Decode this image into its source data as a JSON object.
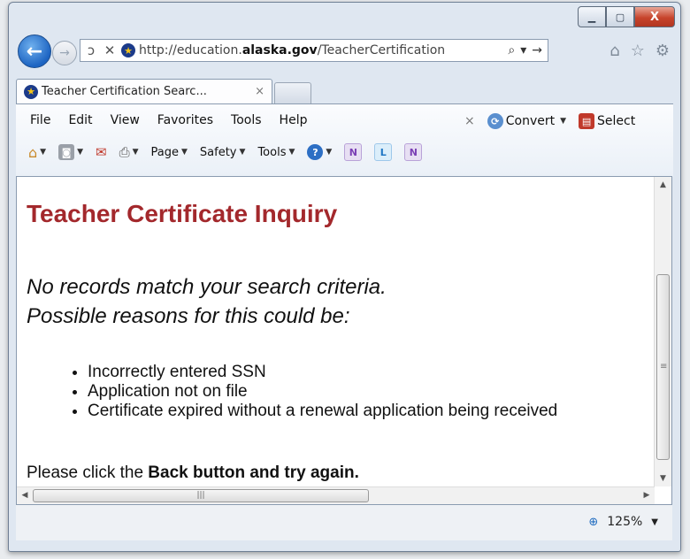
{
  "window": {
    "caption": {
      "minimize": "▁",
      "maximize": "▢",
      "close": "X"
    }
  },
  "nav": {
    "back_icon": "←",
    "forward_icon": "→",
    "refresh_icon": "ↄ",
    "stop_icon": "✕",
    "url_prefix": "http://education.",
    "url_domain": "alaska.gov",
    "url_path": "/TeacherCertification",
    "search_icon": "⌕",
    "dropdown_icon": "▾",
    "go_icon": "→",
    "home_icon": "⌂",
    "favorites_icon": "☆",
    "tools_icon": "⚙"
  },
  "tab": {
    "label": "Teacher Certification Searc...",
    "close": "×"
  },
  "menubar": [
    "File",
    "Edit",
    "View",
    "Favorites",
    "Tools",
    "Help"
  ],
  "toolbar_extra": {
    "close": "×",
    "convert": "Convert",
    "select": "Select"
  },
  "commandbar": {
    "page": "Page",
    "safety": "Safety",
    "tools": "Tools"
  },
  "page": {
    "title": "Teacher Certificate Inquiry",
    "message_line1": "No records match your search criteria.",
    "message_line2": "Possible reasons for this could be:",
    "reasons": [
      "Incorrectly entered SSN",
      "Application not on file",
      "Certificate expired without a renewal application being received"
    ],
    "footer_prefix": "Please click the ",
    "footer_bold": "Back button and try again."
  },
  "status": {
    "zoom": "125%"
  },
  "colors": {
    "title": "#a3282c",
    "accent": "#1d64c2"
  }
}
